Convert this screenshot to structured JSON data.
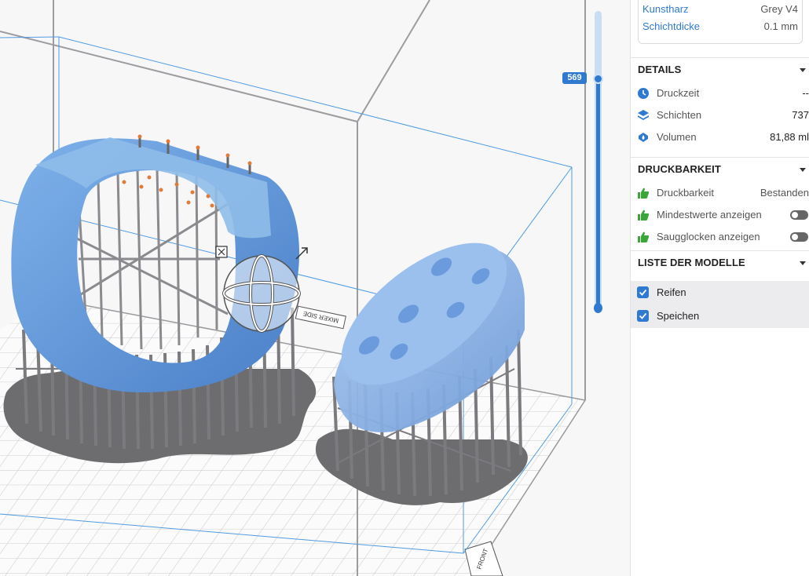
{
  "viewport": {
    "layer_value": "569",
    "labels": {
      "mixer_side": "MIXER SIDE",
      "front": "FRONT"
    }
  },
  "material": {
    "resin_label": "Kunstharz",
    "resin_value": "Grey V4",
    "layer_label": "Schichtdicke",
    "layer_value": "0.1 mm"
  },
  "details": {
    "title": "DETAILS",
    "rows": [
      {
        "icon": "clock-icon",
        "label": "Druckzeit",
        "value": "--"
      },
      {
        "icon": "layers-icon",
        "label": "Schichten",
        "value": "737"
      },
      {
        "icon": "volume-drop-icon",
        "label": "Volumen",
        "value": "81,88 ml"
      }
    ]
  },
  "printability": {
    "title": "DRUCKBARKEIT",
    "rows": [
      {
        "icon": "thumbs-up-icon",
        "label": "Druckbarkeit",
        "value": "Bestanden"
      },
      {
        "icon": "thumbs-up-icon",
        "label": "Mindestwerte anzeigen",
        "toggle": "off"
      },
      {
        "icon": "thumbs-up-icon",
        "label": "Saugglocken anzeigen",
        "toggle": "off"
      }
    ]
  },
  "models": {
    "title": "LISTE DER MODELLE",
    "items": [
      {
        "name": "Reifen",
        "checked": true
      },
      {
        "name": "Speichen",
        "checked": true
      }
    ]
  },
  "colors": {
    "accent": "#2f7ad0",
    "success": "#3aa63a",
    "model_blue": "#5f95d9",
    "support_grey": "#8a8a8d"
  }
}
